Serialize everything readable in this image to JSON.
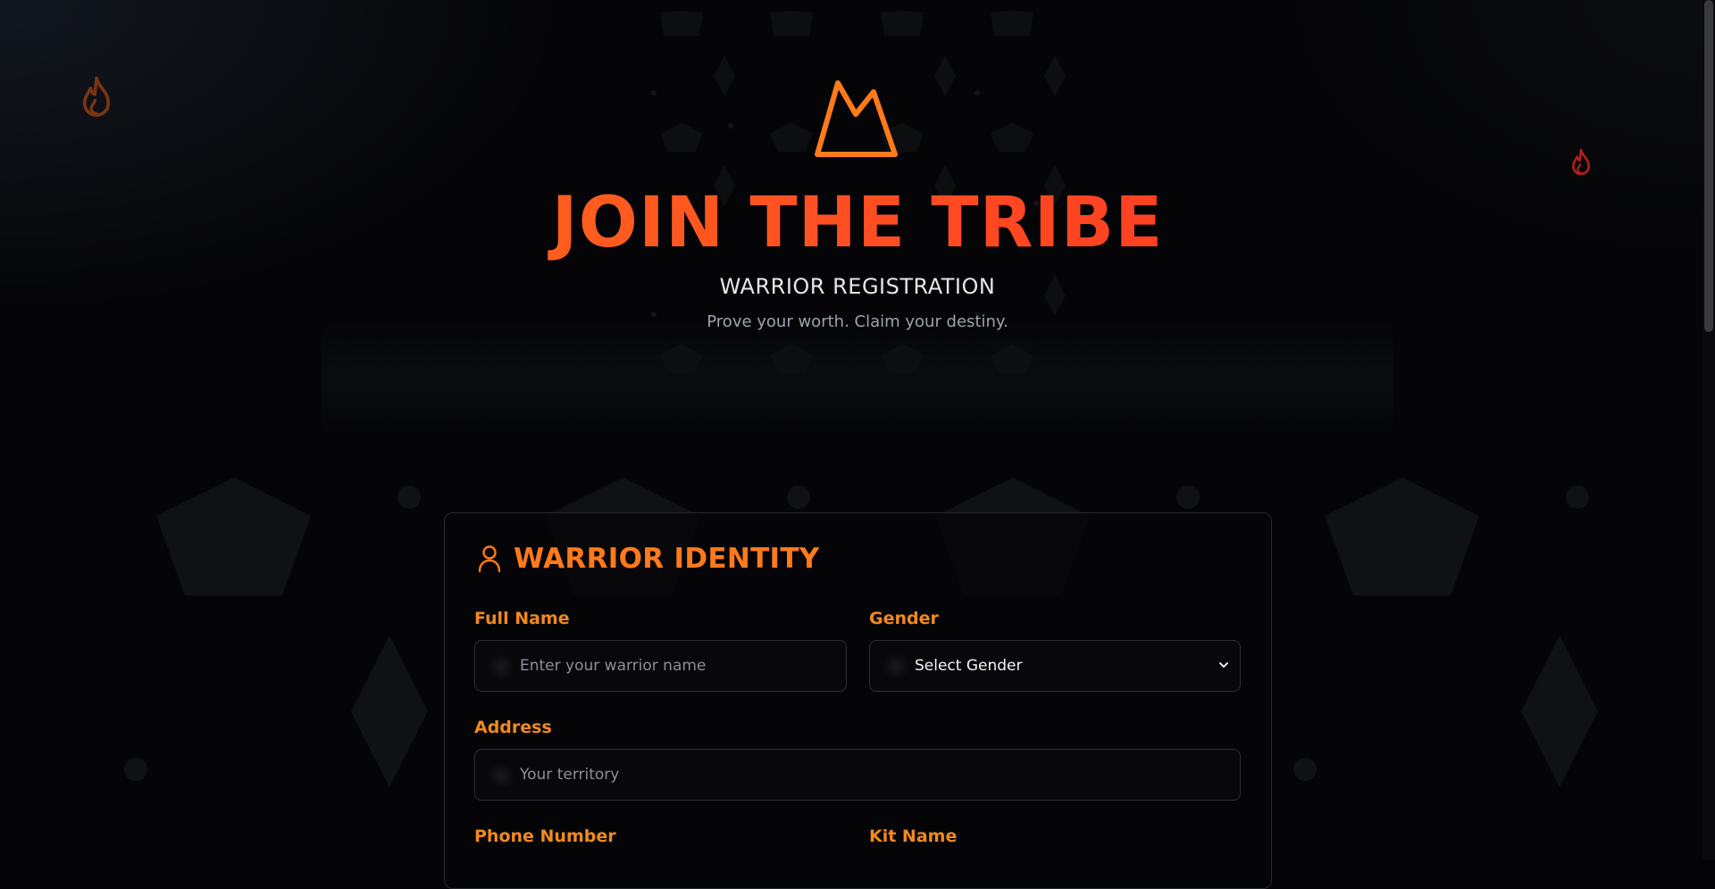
{
  "header": {
    "title": "JOIN THE TRIBE",
    "subtitle": "WARRIOR REGISTRATION",
    "tagline": "Prove your worth. Claim your destiny."
  },
  "colors": {
    "accent": "#ff7a1a",
    "title_gradient_end": "#ff2a1f",
    "background": "#050507"
  },
  "icons": {
    "logo": "mountain-crown-icon",
    "flame": "flame-icon",
    "section": "user-icon"
  },
  "form": {
    "section_title": "WARRIOR IDENTITY",
    "full_name": {
      "label": "Full Name",
      "placeholder": "Enter your warrior name",
      "value": ""
    },
    "gender": {
      "label": "Gender",
      "selected": "Select Gender"
    },
    "address": {
      "label": "Address",
      "placeholder": "Your territory",
      "value": ""
    },
    "phone": {
      "label": "Phone Number"
    },
    "kit_name": {
      "label": "Kit Name"
    }
  }
}
